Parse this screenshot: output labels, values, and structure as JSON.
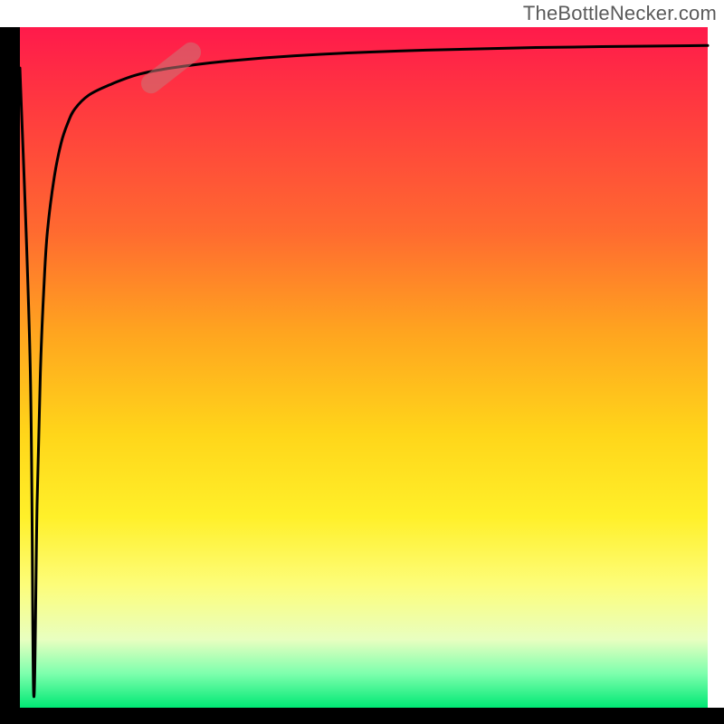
{
  "attribution": "TheBottleNecker.com",
  "chart_data": {
    "type": "line",
    "title": "",
    "xlabel": "",
    "ylabel": "",
    "x_range": [
      0,
      100
    ],
    "y_range": [
      0,
      100
    ],
    "series": [
      {
        "name": "bottleneck-curve",
        "x": [
          0,
          1.5,
          2,
          2.5,
          3,
          3.5,
          4,
          5,
          6,
          7,
          8,
          10,
          13,
          17,
          22,
          30,
          40,
          55,
          75,
          100
        ],
        "y": [
          94,
          50,
          2,
          30,
          50,
          62,
          70,
          78,
          83,
          86,
          88,
          90,
          91.5,
          93,
          94,
          95,
          95.8,
          96.5,
          97,
          97.3
        ]
      }
    ],
    "marker": {
      "x": 22,
      "y": 94,
      "angle_deg": -38
    },
    "background_gradient": {
      "stops": [
        {
          "offset": 0,
          "color": "#ff1a4b"
        },
        {
          "offset": 12,
          "color": "#ff3a3f"
        },
        {
          "offset": 30,
          "color": "#ff6a30"
        },
        {
          "offset": 45,
          "color": "#ffa51f"
        },
        {
          "offset": 60,
          "color": "#ffd61a"
        },
        {
          "offset": 72,
          "color": "#fff02a"
        },
        {
          "offset": 82,
          "color": "#fdfd7a"
        },
        {
          "offset": 90,
          "color": "#e8ffc0"
        },
        {
          "offset": 95,
          "color": "#7dffad"
        },
        {
          "offset": 100,
          "color": "#00e874"
        }
      ]
    }
  }
}
